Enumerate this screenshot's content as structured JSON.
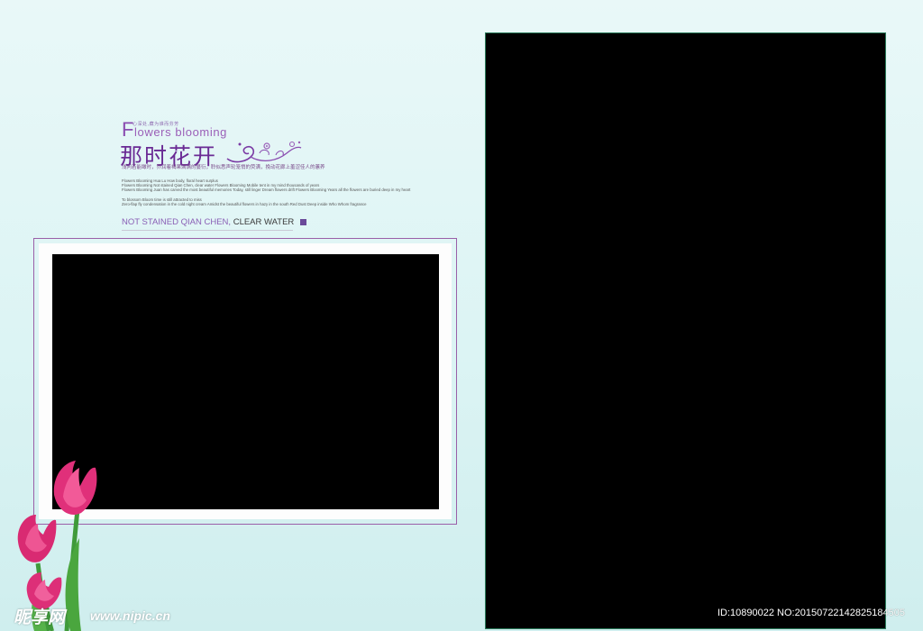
{
  "header": {
    "tiny_cn": "心深处,藏为谁而芬芳",
    "en_title_cap": "F",
    "en_title_rest": "lowers blooming",
    "cn_title": "那时花开",
    "cn_sub": "浅问若能瞰时，乔润着褐果满满的蔓衍，聆似悉声轮笼悄的荧满，挽动花廊上羞涩佳人的蕙养"
  },
  "paragraph": [
    "Flowers Blooming Hua Lu How body, floral heart surplus",
    "Flowers Blooming Not stained Qian Chen, clear water Flowers Blooming Mobile tent in my mind thousands of years",
    "Flowers Blooming Juan has carved the most beautiful memories Today, still linger Dream flowers drift Flowers Blooming Years all the flowers are buried deep in my heart",
    "To blossom Bloom time is still attracted to miss",
    "Zero-flap fly condensation in the cold night cream Amidst the beautiful flowers in hazy in the south Red Dust Deep inside Who Whom fragrance"
  ],
  "tagline": {
    "light": "NOT STAINED QIAN CHEN, ",
    "dark": "CLEAR WATER"
  },
  "watermark": {
    "logo": "昵享网",
    "url": "www.nipic.cn",
    "id_text": "ID:10890022 NO:20150722142825184505"
  },
  "colors": {
    "accent_purple": "#6a2a94",
    "frame_border": "#9a5fa8",
    "tulip_pink": "#e0307a"
  }
}
